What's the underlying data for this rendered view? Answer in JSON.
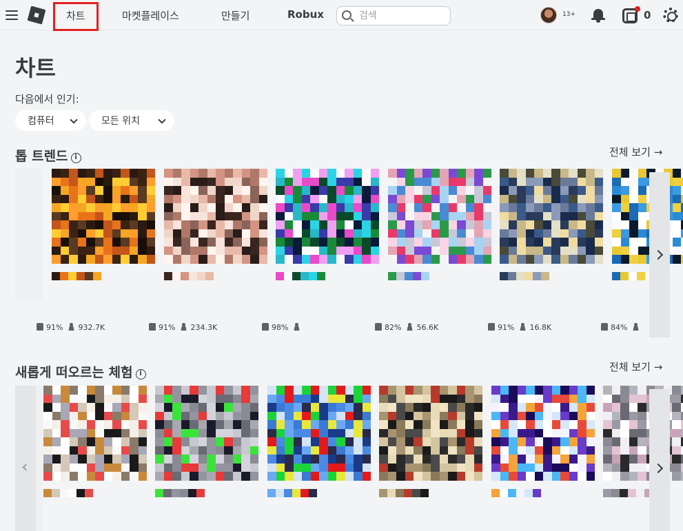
{
  "nav": {
    "charts": "차트",
    "marketplace": "마켓플레이스",
    "create": "만들기",
    "robux": "Robux",
    "search_placeholder": "검색",
    "age_badge": "13+",
    "robux_count": "0"
  },
  "page": {
    "title": "차트",
    "popular_in": "다음에서 인기:",
    "filter_device": "컴퓨터",
    "filter_location": "모든 위치"
  },
  "sections": [
    {
      "title": "톱 트렌드",
      "see_all": "전체 보기 →",
      "items": [
        {
          "rating": "91%",
          "players": "932.7K"
        },
        {
          "rating": "91%",
          "players": "234.3K"
        },
        {
          "rating": "98%",
          "players": ""
        },
        {
          "rating": "82%",
          "players": "56.6K"
        },
        {
          "rating": "91%",
          "players": "16.8K"
        },
        {
          "rating": "84%",
          "players": ""
        }
      ]
    },
    {
      "title": "새롭게 떠오르는 체험",
      "see_all": "전체 보기 →",
      "items": [
        {},
        {},
        {},
        {},
        {},
        {}
      ]
    }
  ],
  "icons": [
    "menu-icon",
    "roblox-logo",
    "search-icon",
    "avatar",
    "notification-bell-icon",
    "robux-icon",
    "settings-gear-icon",
    "info-icon",
    "chevron-down-icon",
    "chevron-right-icon",
    "chevron-left-icon",
    "thumbs-up-icon",
    "person-icon"
  ],
  "colors": {
    "accent_highlight": "#e0201f",
    "background": "#f2f4f5",
    "text": "#393b3d"
  }
}
